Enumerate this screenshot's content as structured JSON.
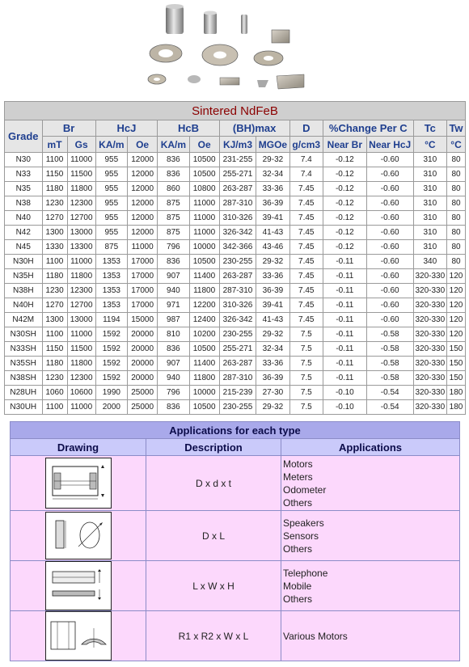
{
  "table": {
    "title": "Sintered NdFeB",
    "headers_top": [
      "Grade",
      "Br",
      "HcJ",
      "HcB",
      "(BH)max",
      "D",
      "%Change Per C",
      "Tc",
      "Tw"
    ],
    "headers_units": [
      "mT",
      "Gs",
      "KA/m",
      "Oe",
      "KA/m",
      "Oe",
      "KJ/m3",
      "MGOe",
      "g/cm3",
      "Near Br",
      "Near HcJ",
      "°C",
      "°C"
    ],
    "rows": [
      [
        "N30",
        "1100",
        "11000",
        "955",
        "12000",
        "836",
        "10500",
        "231-255",
        "29-32",
        "7.4",
        "-0.12",
        "-0.60",
        "310",
        "80"
      ],
      [
        "N33",
        "1150",
        "11500",
        "955",
        "12000",
        "836",
        "10500",
        "255-271",
        "32-34",
        "7.4",
        "-0.12",
        "-0.60",
        "310",
        "80"
      ],
      [
        "N35",
        "1180",
        "11800",
        "955",
        "12000",
        "860",
        "10800",
        "263-287",
        "33-36",
        "7.45",
        "-0.12",
        "-0.60",
        "310",
        "80"
      ],
      [
        "N38",
        "1230",
        "12300",
        "955",
        "12000",
        "875",
        "11000",
        "287-310",
        "36-39",
        "7.45",
        "-0.12",
        "-0.60",
        "310",
        "80"
      ],
      [
        "N40",
        "1270",
        "12700",
        "955",
        "12000",
        "875",
        "11000",
        "310-326",
        "39-41",
        "7.45",
        "-0.12",
        "-0.60",
        "310",
        "80"
      ],
      [
        "N42",
        "1300",
        "13000",
        "955",
        "12000",
        "875",
        "11000",
        "326-342",
        "41-43",
        "7.45",
        "-0.12",
        "-0.60",
        "310",
        "80"
      ],
      [
        "N45",
        "1330",
        "13300",
        "875",
        "11000",
        "796",
        "10000",
        "342-366",
        "43-46",
        "7.45",
        "-0.12",
        "-0.60",
        "310",
        "80"
      ],
      [
        "N30H",
        "1100",
        "11000",
        "1353",
        "17000",
        "836",
        "10500",
        "230-255",
        "29-32",
        "7.45",
        "-0.11",
        "-0.60",
        "340",
        "80"
      ],
      [
        "N35H",
        "1180",
        "11800",
        "1353",
        "17000",
        "907",
        "11400",
        "263-287",
        "33-36",
        "7.45",
        "-0.11",
        "-0.60",
        "320-330",
        "120"
      ],
      [
        "N38H",
        "1230",
        "12300",
        "1353",
        "17000",
        "940",
        "11800",
        "287-310",
        "36-39",
        "7.45",
        "-0.11",
        "-0.60",
        "320-330",
        "120"
      ],
      [
        "N40H",
        "1270",
        "12700",
        "1353",
        "17000",
        "971",
        "12200",
        "310-326",
        "39-41",
        "7.45",
        "-0.11",
        "-0.60",
        "320-330",
        "120"
      ],
      [
        "N42M",
        "1300",
        "13000",
        "1194",
        "15000",
        "987",
        "12400",
        "326-342",
        "41-43",
        "7.45",
        "-0.11",
        "-0.60",
        "320-330",
        "120"
      ],
      [
        "N30SH",
        "1100",
        "11000",
        "1592",
        "20000",
        "810",
        "10200",
        "230-255",
        "29-32",
        "7.5",
        "-0.11",
        "-0.58",
        "320-330",
        "120"
      ],
      [
        "N33SH",
        "1150",
        "11500",
        "1592",
        "20000",
        "836",
        "10500",
        "255-271",
        "32-34",
        "7.5",
        "-0.11",
        "-0.58",
        "320-330",
        "150"
      ],
      [
        "N35SH",
        "1180",
        "11800",
        "1592",
        "20000",
        "907",
        "11400",
        "263-287",
        "33-36",
        "7.5",
        "-0.11",
        "-0.58",
        "320-330",
        "150"
      ],
      [
        "N38SH",
        "1230",
        "12300",
        "1592",
        "20000",
        "940",
        "11800",
        "287-310",
        "36-39",
        "7.5",
        "-0.11",
        "-0.58",
        "320-330",
        "150"
      ],
      [
        "N28UH",
        "1060",
        "10600",
        "1990",
        "25000",
        "796",
        "10000",
        "215-239",
        "27-30",
        "7.5",
        "-0.10",
        "-0.54",
        "320-330",
        "180"
      ],
      [
        "N30UH",
        "1100",
        "11000",
        "2000",
        "25000",
        "836",
        "10500",
        "230-255",
        "29-32",
        "7.5",
        "-0.10",
        "-0.54",
        "320-330",
        "180"
      ]
    ]
  },
  "applications": {
    "title": "Applications for each type",
    "headers": [
      "Drawing",
      "Description",
      "Applications"
    ],
    "rows": [
      {
        "drawing": "ring-magnet-drawing",
        "description": "D x d x t",
        "applications": [
          "Motors",
          "Meters",
          "Odometer",
          "Others"
        ]
      },
      {
        "drawing": "disc-magnet-drawing",
        "description": "D x L",
        "applications": [
          "Speakers",
          "Sensors",
          "Others"
        ]
      },
      {
        "drawing": "block-magnet-drawing",
        "description": "L x W x H",
        "applications": [
          "Telephone",
          "Mobile",
          "Others"
        ]
      },
      {
        "drawing": "arc-magnet-drawing",
        "description": "R1 x R2 x W x L",
        "applications": [
          "Various Motors"
        ]
      }
    ]
  },
  "colors": {
    "title_red": "#8b0000",
    "header_blue": "#1f3f8f",
    "apps_title_bg": "#a9a9ea",
    "apps_header_bg": "#cacafa",
    "apps_row_bg": "#fcd8fc"
  }
}
